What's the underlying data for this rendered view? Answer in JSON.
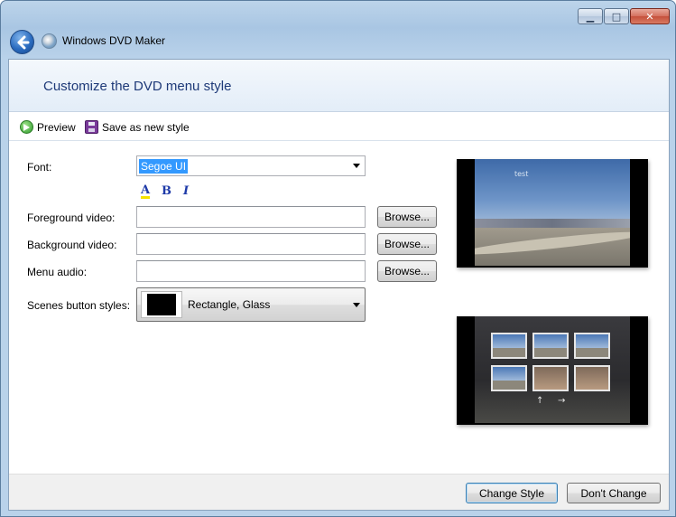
{
  "window": {
    "title": "Windows DVD Maker",
    "caption_buttons": {
      "minimize": "▁",
      "maximize": "□",
      "close": "✕"
    }
  },
  "header": {
    "title": "Customize the DVD menu style"
  },
  "toolbar": {
    "preview_label": "Preview",
    "save_label": "Save as new style"
  },
  "form": {
    "font": {
      "label": "Font:",
      "value": "Segoe UI"
    },
    "format_buttons": {
      "color": "A",
      "bold": "B",
      "italic": "I"
    },
    "foreground_video": {
      "label": "Foreground video:",
      "value": "",
      "browse": "Browse..."
    },
    "background_video": {
      "label": "Background video:",
      "value": "",
      "browse": "Browse..."
    },
    "menu_audio": {
      "label": "Menu audio:",
      "value": "",
      "browse": "Browse..."
    },
    "scenes_button_styles": {
      "label": "Scenes button styles:",
      "value": "Rectangle, Glass",
      "swatch_color": "#000000"
    }
  },
  "previews": {
    "main_title_text": "test",
    "scenes_nav": {
      "up": "↑",
      "right": "→"
    }
  },
  "footer": {
    "change_style": "Change Style",
    "dont_change": "Don't Change"
  }
}
